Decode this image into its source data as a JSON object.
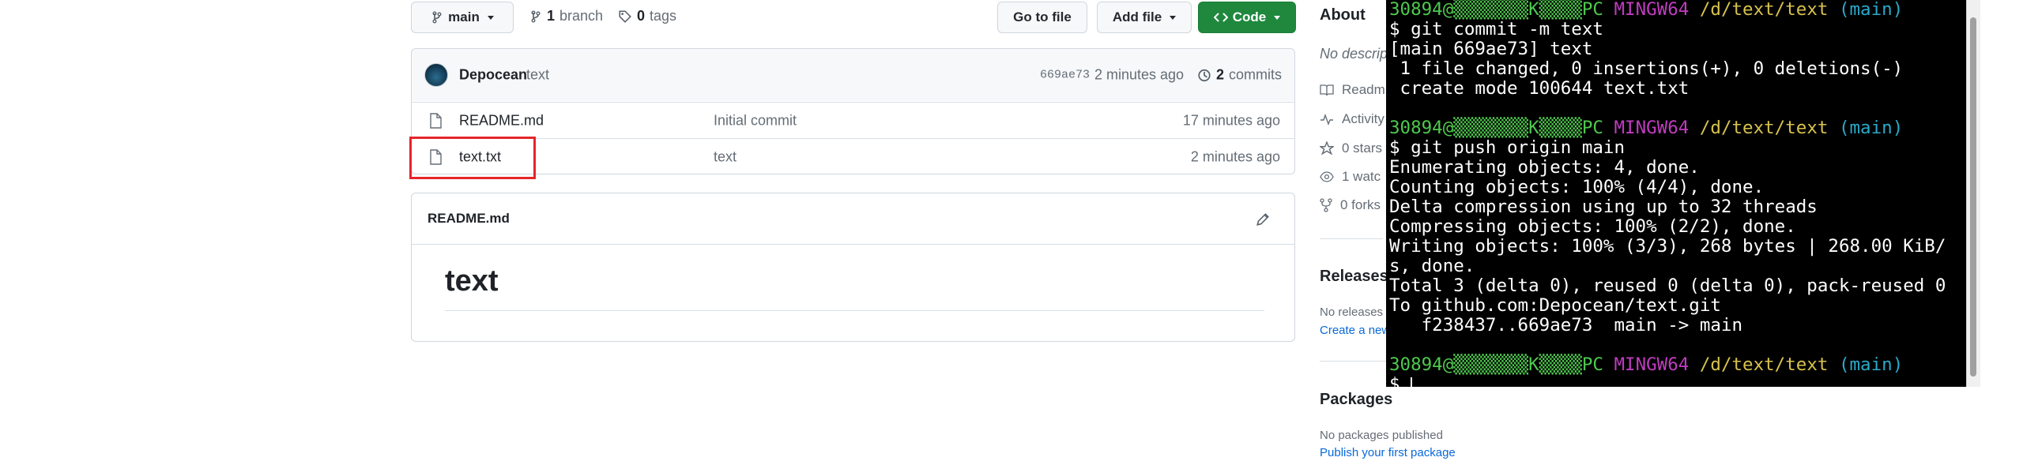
{
  "toolbar": {
    "branch_label": "main",
    "branch_count": "1",
    "branch_word": "branch",
    "tag_count": "0",
    "tag_word": "tags",
    "go_to_file": "Go to file",
    "add_file": "Add file",
    "code": "Code"
  },
  "commit_bar": {
    "author": "Depocean",
    "message": "text",
    "hash": "669ae73",
    "time": "2 minutes ago",
    "commit_count": "2",
    "commit_word": "commits"
  },
  "files": [
    {
      "name": "README.md",
      "message": "Initial commit",
      "time": "17 minutes ago"
    },
    {
      "name": "text.txt",
      "message": "text",
      "time": "2 minutes ago"
    }
  ],
  "readme": {
    "filename": "README.md",
    "heading": "text"
  },
  "sidebar": {
    "about": "About",
    "no_description": "No descrip",
    "readme": "Readm",
    "activity": "Activity",
    "stars": "0 stars",
    "watchers": "1 watc",
    "forks": "0 forks",
    "releases": "Releases",
    "no_releases": "No releases p",
    "create_release": "Create a new",
    "packages": "Packages",
    "no_packages": "No packages published",
    "publish_package": "Publish your first package"
  },
  "terminal": {
    "lines": [
      [
        {
          "t": "30894@",
          "c": "g"
        },
        {
          "t": "▒▒▒▒▒▒▒",
          "c": "g"
        },
        {
          "t": "K",
          "c": "g"
        },
        {
          "t": "▒▒▒▒",
          "c": "g"
        },
        {
          "t": "PC ",
          "c": "g"
        },
        {
          "t": "MINGW64 ",
          "c": "m"
        },
        {
          "t": "/d/text/text ",
          "c": "y"
        },
        {
          "t": "(main)",
          "c": "c"
        }
      ],
      [
        {
          "t": "$ git commit -m text",
          "c": "w"
        }
      ],
      [
        {
          "t": "[main 669ae73] text",
          "c": "w"
        }
      ],
      [
        {
          "t": " 1 file changed, 0 insertions(+), 0 deletions(-)",
          "c": "w"
        }
      ],
      [
        {
          "t": " create mode 100644 text.txt",
          "c": "w"
        }
      ],
      [
        {
          "t": "",
          "c": "w"
        }
      ],
      [
        {
          "t": "30894@",
          "c": "g"
        },
        {
          "t": "▒▒▒▒▒▒▒",
          "c": "g"
        },
        {
          "t": "K",
          "c": "g"
        },
        {
          "t": "▒▒▒▒",
          "c": "g"
        },
        {
          "t": "PC ",
          "c": "g"
        },
        {
          "t": "MINGW64 ",
          "c": "m"
        },
        {
          "t": "/d/text/text ",
          "c": "y"
        },
        {
          "t": "(main)",
          "c": "c"
        }
      ],
      [
        {
          "t": "$ git push origin main",
          "c": "w"
        }
      ],
      [
        {
          "t": "Enumerating objects: 4, done.",
          "c": "w"
        }
      ],
      [
        {
          "t": "Counting objects: 100% (4/4), done.",
          "c": "w"
        }
      ],
      [
        {
          "t": "Delta compression using up to 32 threads",
          "c": "w"
        }
      ],
      [
        {
          "t": "Compressing objects: 100% (2/2), done.",
          "c": "w"
        }
      ],
      [
        {
          "t": "Writing objects: 100% (3/3), 268 bytes | 268.00 KiB/",
          "c": "w"
        }
      ],
      [
        {
          "t": "s, done.",
          "c": "w"
        }
      ],
      [
        {
          "t": "Total 3 (delta 0), reused 0 (delta 0), pack-reused 0",
          "c": "w"
        }
      ],
      [
        {
          "t": "To github.com:Depocean/text.git",
          "c": "w"
        }
      ],
      [
        {
          "t": "   f238437..669ae73  main -> main",
          "c": "w"
        }
      ],
      [
        {
          "t": "",
          "c": "w"
        }
      ],
      [
        {
          "t": "30894@",
          "c": "g"
        },
        {
          "t": "▒▒▒▒▒▒▒",
          "c": "g"
        },
        {
          "t": "K",
          "c": "g"
        },
        {
          "t": "▒▒▒▒",
          "c": "g"
        },
        {
          "t": "PC ",
          "c": "g"
        },
        {
          "t": "MINGW64 ",
          "c": "m"
        },
        {
          "t": "/d/text/text ",
          "c": "y"
        },
        {
          "t": "(main)",
          "c": "c"
        }
      ],
      [
        {
          "t": "$ ",
          "c": "w"
        }
      ]
    ]
  },
  "highlight_color": "#e5252a"
}
